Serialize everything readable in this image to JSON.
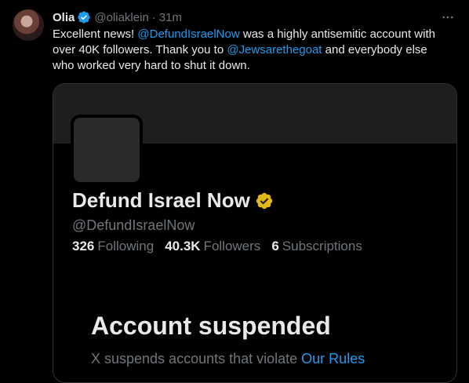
{
  "tweet": {
    "display_name": "Olia",
    "handle": "@oliaklein",
    "separator": "·",
    "time": "31m",
    "text_part1": "Excellent news! ",
    "mention1": "@DefundIsraelNow",
    "text_part2": " was a highly antisemitic account with over 40K followers. Thank you to ",
    "mention2": "@Jewsarethegoat",
    "text_part3": " and everybody else who worked very hard to shut it down."
  },
  "embedded_profile": {
    "name": "Defund Israel Now",
    "handle": "@DefundIsraelNow",
    "following_count": "326",
    "following_label": "Following",
    "followers_count": "40.3K",
    "followers_label": "Followers",
    "subscriptions_count": "6",
    "subscriptions_label": "Subscriptions",
    "suspended_title": "Account suspended",
    "suspended_desc_prefix": "X suspends accounts that violate ",
    "suspended_desc_link": "Our Rules"
  },
  "colors": {
    "background": "#000000",
    "text_primary": "#e7e9ea",
    "text_secondary": "#71767b",
    "link_blue": "#1d9bf0",
    "verified_gold": "#e2b719",
    "verified_blue": "#1d9bf0"
  },
  "icons": [
    "verified-badge-icon",
    "more-options-icon",
    "gold-verified-badge-icon"
  ]
}
